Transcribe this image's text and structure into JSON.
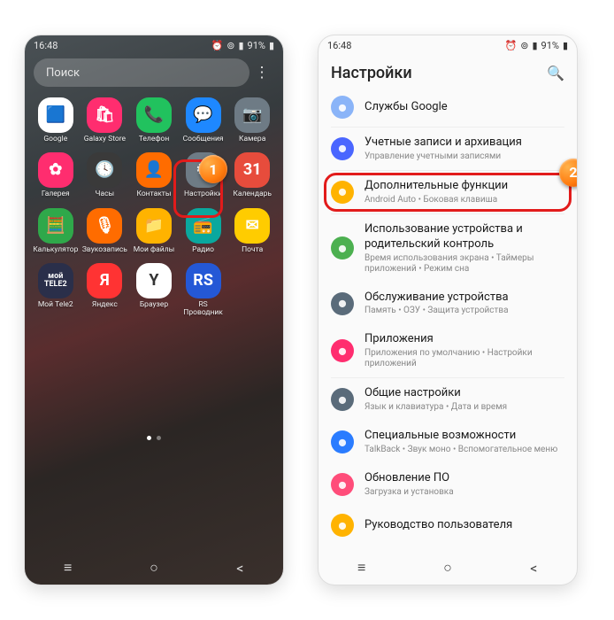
{
  "status": {
    "time": "16:48",
    "battery": "91%"
  },
  "left": {
    "search_placeholder": "Поиск",
    "apps": [
      {
        "label": "Google",
        "bg": "bg-white",
        "glyph": "🟦"
      },
      {
        "label": "Galaxy Store",
        "bg": "bg-pink",
        "glyph": "🛍"
      },
      {
        "label": "Телефон",
        "bg": "bg-green",
        "glyph": "📞"
      },
      {
        "label": "Сообщения",
        "bg": "bg-blue",
        "glyph": "💬"
      },
      {
        "label": "Камера",
        "bg": "bg-gray",
        "glyph": "📷"
      },
      {
        "label": "Галерея",
        "bg": "bg-pink",
        "glyph": "✿"
      },
      {
        "label": "Часы",
        "bg": "bg-dark",
        "glyph": "🕓"
      },
      {
        "label": "Контакты",
        "bg": "bg-orange",
        "glyph": "👤"
      },
      {
        "label": "Настройки",
        "bg": "bg-gray",
        "glyph": "⚙"
      },
      {
        "label": "Календарь",
        "bg": "bg-red",
        "glyph": "31"
      },
      {
        "label": "Калькулятор",
        "bg": "bg-greend",
        "glyph": "🧮"
      },
      {
        "label": "Звукозапись",
        "bg": "bg-orange",
        "glyph": "🎙"
      },
      {
        "label": "Мои файлы",
        "bg": "bg-yfolder",
        "glyph": "📁"
      },
      {
        "label": "Радио",
        "bg": "bg-teal",
        "glyph": "📻"
      },
      {
        "label": "Почта",
        "bg": "bg-yellow",
        "glyph": "✉"
      },
      {
        "label": "Мой Tele2",
        "bg": "bg-darkblue",
        "glyph": "мой\\nTELE2"
      },
      {
        "label": "Яндекс",
        "bg": "bg-yred",
        "glyph": "Я"
      },
      {
        "label": "Браузер",
        "bg": "bg-white",
        "glyph": "Y"
      },
      {
        "label": "RS\\nПроводник",
        "bg": "bg-rsblue",
        "glyph": "RS"
      }
    ],
    "step_badge": "1"
  },
  "right": {
    "title": "Настройки",
    "step_badge": "2",
    "items": [
      {
        "icon": "#8ab4f8",
        "title": "Службы Google",
        "sub": ""
      },
      {
        "icon": "#4a66ff",
        "title": "Учетные записи и архивация",
        "sub": "Управление учетными записями"
      },
      {
        "icon": "#ffb300",
        "title": "Дополнительные функции",
        "sub": "Android Auto • Боковая клавиша",
        "hl": true
      },
      {
        "icon": "#4cb050",
        "title": "Использование устройства и родительский контроль",
        "sub": "Время использования экрана • Таймеры приложений • Режим сна"
      },
      {
        "icon": "#5a6b7a",
        "title": "Обслуживание устройства",
        "sub": "Память • ОЗУ • Защита устройства"
      },
      {
        "icon": "#ff2d6f",
        "title": "Приложения",
        "sub": "Приложения по умолчанию • Настройки приложений"
      },
      {
        "icon": "#5a6b7a",
        "title": "Общие настройки",
        "sub": "Язык и клавиатура • Дата и время"
      },
      {
        "icon": "#2a7cff",
        "title": "Специальные возможности",
        "sub": "TalkBack • Звук моно • Вспомогательное меню"
      },
      {
        "icon": "#ff4d7a",
        "title": "Обновление ПО",
        "sub": "Загрузка и установка"
      },
      {
        "icon": "#ffb300",
        "title": "Руководство пользователя",
        "sub": ""
      }
    ]
  }
}
